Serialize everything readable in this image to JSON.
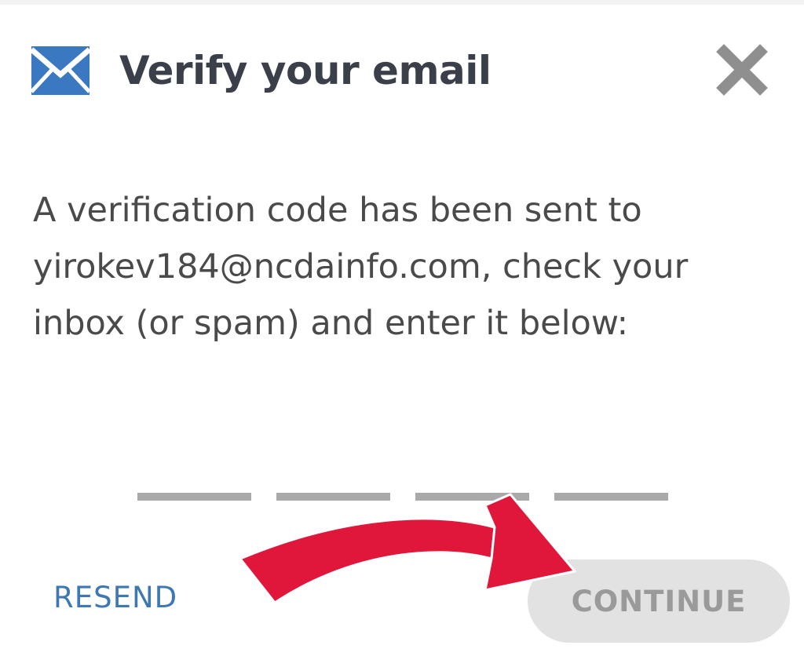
{
  "dialog": {
    "title": "Verify your email",
    "message_lines": [
      "A verification code has been sent to",
      "yirokev184@ncdainfo.com, check your",
      "inbox (or spam) and enter it below:"
    ],
    "code_slots": 4,
    "resend_label": "RESEND",
    "continue_label": "CONTINUE"
  },
  "icons": {
    "header": "mail-icon",
    "close": "close-icon",
    "overlay": "red-arrow-annotation"
  },
  "colors": {
    "title": "#3a3f4a",
    "mail_icon": "#3a78c2",
    "link": "#3e78b3",
    "continue_bg": "#e2e2e2",
    "continue_text": "#9a9a9a",
    "code_slot": "#a9a9a9",
    "arrow": "#e0163a"
  }
}
